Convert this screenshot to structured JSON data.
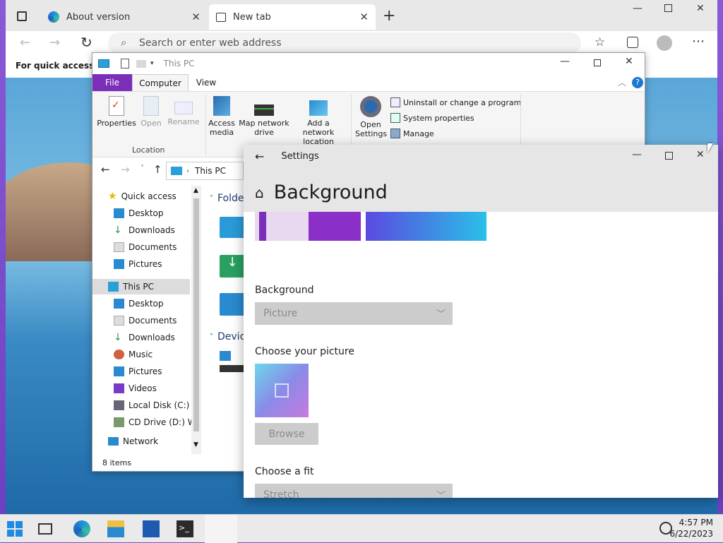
{
  "browser": {
    "tabs": [
      {
        "label": "About version"
      },
      {
        "label": "New tab"
      }
    ],
    "address_placeholder": "Search or enter web address",
    "favorites_bar_text": "For quick access, pla"
  },
  "explorer": {
    "title": "This PC",
    "ribbon_tabs": [
      "File",
      "Computer",
      "View"
    ],
    "ribbon": {
      "properties": "Properties",
      "open": "Open",
      "rename": "Rename",
      "location_group": "Location",
      "access_media": "Access media",
      "map_network_drive": "Map network drive",
      "add_network_location": "Add a network location",
      "open_settings": "Open Settings",
      "uninstall": "Uninstall or change a program",
      "system_properties": "System properties",
      "manage": "Manage"
    },
    "address": "This PC",
    "nav": {
      "quick_access": "Quick access",
      "qa_items": [
        "Desktop",
        "Downloads",
        "Documents",
        "Pictures"
      ],
      "this_pc": "This PC",
      "pc_items": [
        "Desktop",
        "Documents",
        "Downloads",
        "Music",
        "Pictures",
        "Videos",
        "Local Disk (C:)",
        "CD Drive (D:) Wi"
      ],
      "network": "Network"
    },
    "content": {
      "folders_header": "Folde",
      "devices_header": "Devic"
    },
    "status": "8 items"
  },
  "settings": {
    "window_title": "Settings",
    "heading": "Background",
    "background_label": "Background",
    "background_value": "Picture",
    "choose_picture_label": "Choose your picture",
    "browse_label": "Browse",
    "fit_label": "Choose a fit",
    "fit_value": "Stretch"
  },
  "taskbar": {
    "time": "4:57 PM",
    "date": "6/22/2023"
  },
  "colors": {
    "accent": "#7b2fb8",
    "file_tab": "#7b2fb8",
    "taskbar": "#eaeaea"
  }
}
